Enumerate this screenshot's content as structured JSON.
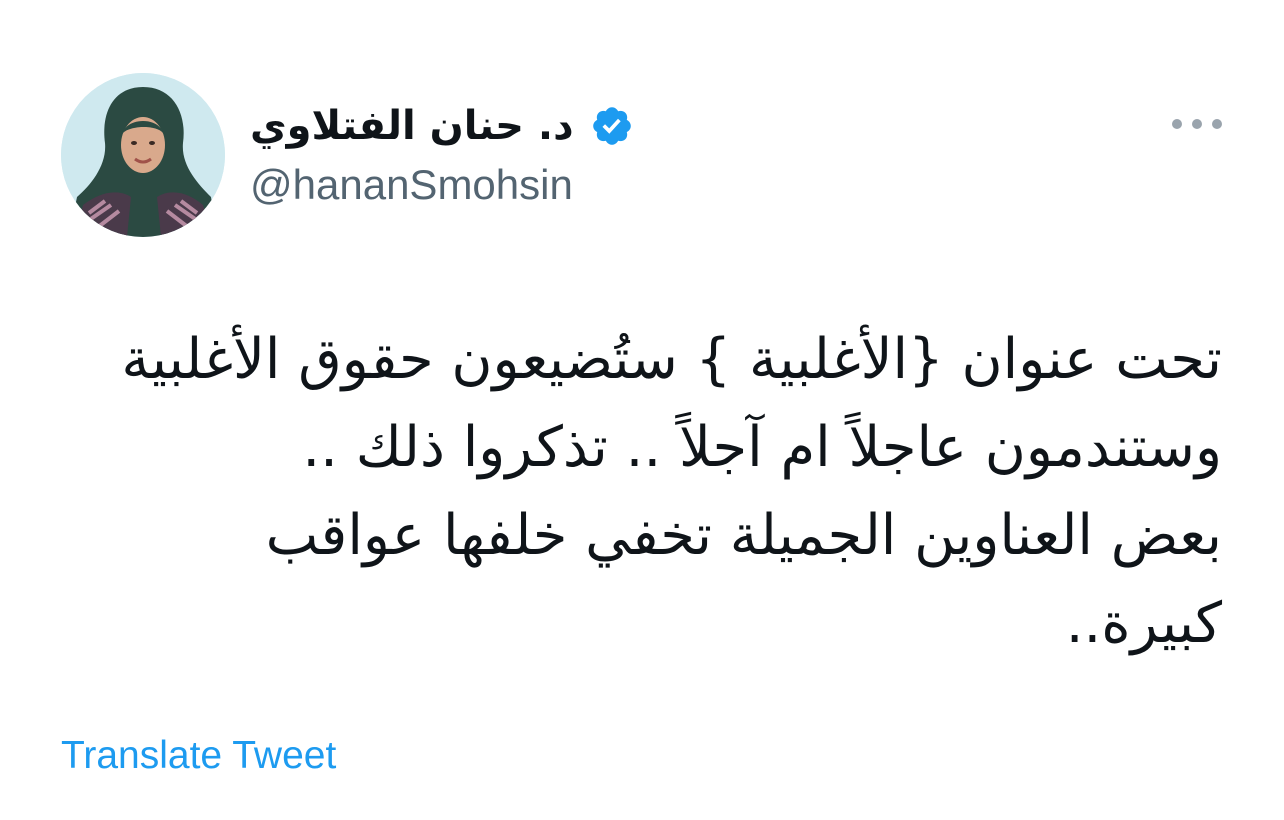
{
  "author": {
    "display_name": "د. حنان الفتلاوي",
    "handle": "@hananSmohsin",
    "verified": true,
    "verified_color": "#1d9bf0",
    "avatar_icon": "profile-photo"
  },
  "more_icon": "ellipsis-horizontal-icon",
  "tweet": {
    "lines": [
      "تحت عنوان {الأغلبية } ستُضيعون حقوق الأغلبية",
      "وستندمون عاجلاً ام آجلاً .. تذكروا ذلك ..",
      "بعض العناوين الجميلة تخفي خلفها عواقب",
      "كبيرة.."
    ]
  },
  "translate": {
    "label": "Translate Tweet",
    "color": "#1d9bf0"
  }
}
